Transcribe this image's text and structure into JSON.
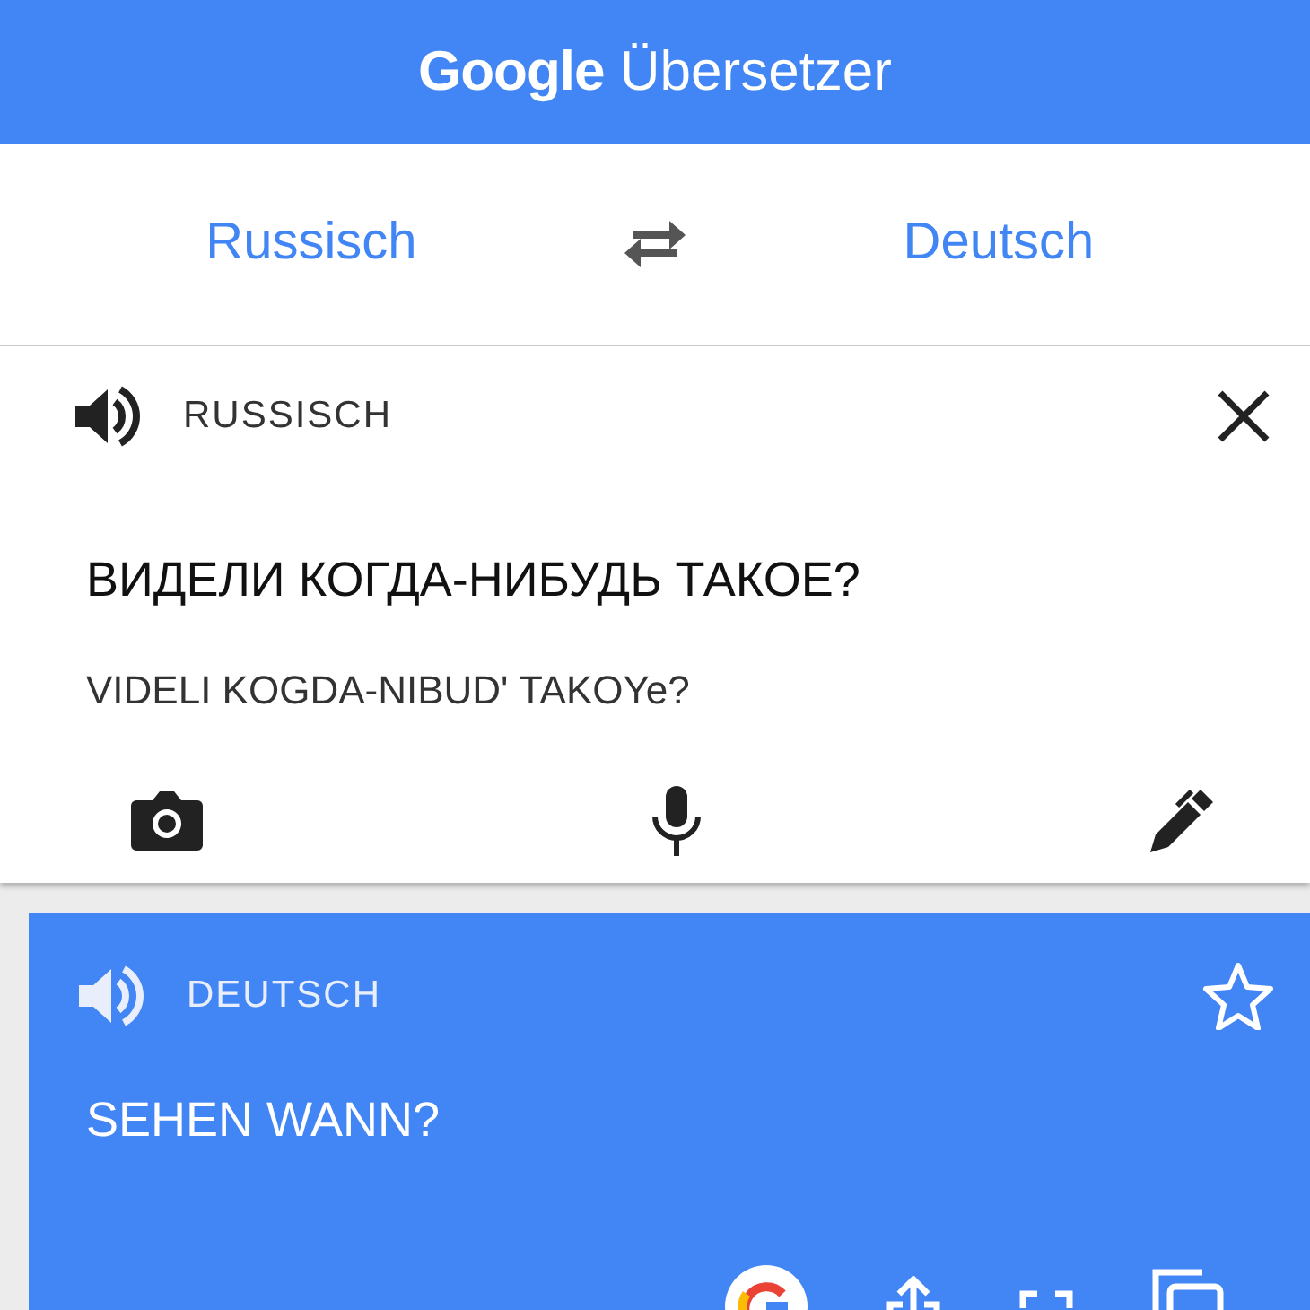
{
  "app_bar": {
    "brand": "Google",
    "title": "Übersetzer"
  },
  "language_bar": {
    "source": "Russisch",
    "target": "Deutsch"
  },
  "input_card": {
    "language": "RUSSISCH",
    "text": "ВИДЕЛИ КОГДА-НИБУДЬ ТАКОЕ?",
    "transliteration": "VIDELI KOGDA-NIBUD' TAKOYe?"
  },
  "result_card": {
    "language": "DEUTSCH",
    "text": "SEHEN WANN?",
    "starred": false
  }
}
